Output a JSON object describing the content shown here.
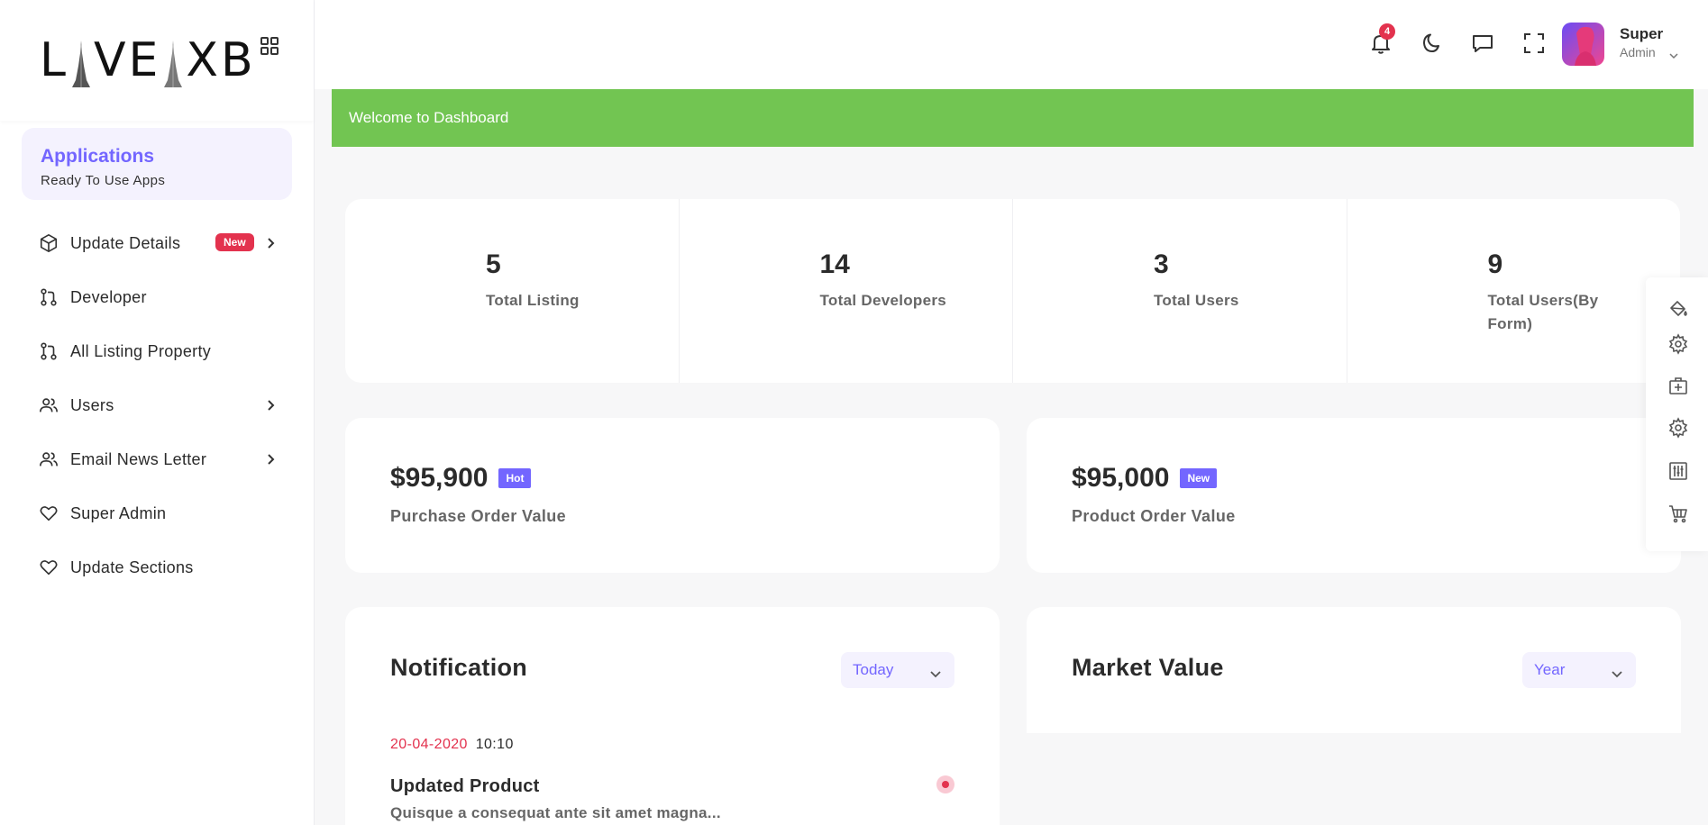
{
  "brand": {
    "logo_text_left": "L",
    "logo_text_mid": "VE",
    "logo_text_right": "XB"
  },
  "sidebar": {
    "apps_card": {
      "title": "Applications",
      "subtitle": "Ready To Use Apps"
    },
    "items": [
      {
        "label": "Update Details",
        "icon": "box-icon",
        "badge": "New",
        "has_chevron": true
      },
      {
        "label": "Developer",
        "icon": "git-pull-icon",
        "has_chevron": false
      },
      {
        "label": "All Listing Property",
        "icon": "git-pull-icon",
        "has_chevron": false
      },
      {
        "label": "Users",
        "icon": "users-icon",
        "has_chevron": true
      },
      {
        "label": "Email News Letter",
        "icon": "users-icon",
        "has_chevron": true
      },
      {
        "label": "Super Admin",
        "icon": "heart-icon",
        "has_chevron": false
      },
      {
        "label": "Update Sections",
        "icon": "heart-icon",
        "has_chevron": false
      }
    ]
  },
  "header": {
    "notification_count": "4",
    "profile": {
      "name": "Super",
      "role": "Admin"
    }
  },
  "welcome": {
    "text": "Welcome to Dashboard"
  },
  "stats": [
    {
      "value": "5",
      "label": "Total Listing"
    },
    {
      "value": "14",
      "label": "Total Developers"
    },
    {
      "value": "3",
      "label": "Total Users"
    },
    {
      "value": "9",
      "label": "Total Users(By Form)"
    }
  ],
  "orders": [
    {
      "value": "$95,900",
      "badge": "Hot",
      "label": "Purchase Order Value"
    },
    {
      "value": "$95,000",
      "badge": "New",
      "label": "Product Order Value"
    }
  ],
  "notification_card": {
    "title": "Notification",
    "filter": "Today",
    "entry": {
      "date": "20-04-2020",
      "time": "10:10",
      "title": "Updated Product",
      "description": "Quisque a consequat ante sit amet magna..."
    }
  },
  "market_card": {
    "title": "Market Value",
    "filter": "Year"
  },
  "colors": {
    "accent": "#7366ff",
    "success": "#72c552",
    "danger": "#e3324e"
  }
}
